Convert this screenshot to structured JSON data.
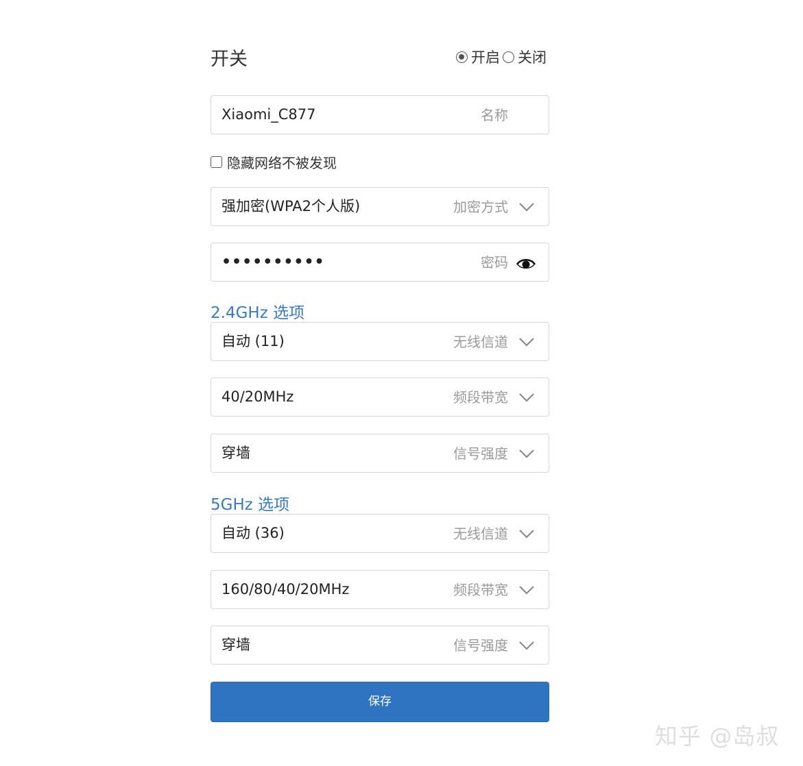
{
  "switch": {
    "title": "开关",
    "on_label": "开启",
    "off_label": "关闭",
    "selected": "on"
  },
  "name_field": {
    "value": "Xiaomi_C877",
    "hint": "名称"
  },
  "hide_network": {
    "label": "隐藏网络不被发现",
    "checked": false
  },
  "encryption": {
    "value": "强加密(WPA2个人版)",
    "hint": "加密方式"
  },
  "password": {
    "value": "••••••••••",
    "hint": "密码"
  },
  "band_24": {
    "title": "2.4GHz 选项",
    "channel": {
      "value": "自动 (11)",
      "hint": "无线信道"
    },
    "bandwidth": {
      "value": "40/20MHz",
      "hint": "频段带宽"
    },
    "signal": {
      "value": "穿墙",
      "hint": "信号强度"
    }
  },
  "band_5": {
    "title": "5GHz 选项",
    "channel": {
      "value": "自动 (36)",
      "hint": "无线信道"
    },
    "bandwidth": {
      "value": "160/80/40/20MHz",
      "hint": "频段带宽"
    },
    "signal": {
      "value": "穿墙",
      "hint": "信号强度"
    }
  },
  "save_label": "保存",
  "watermark": "知乎 @岛叔",
  "colors": {
    "accent": "#2f74c0",
    "section_title": "#3a7abf",
    "hint": "#9a9a9a",
    "border": "#d6d6d6"
  },
  "icons": {
    "dropdown": "chevron-down-icon",
    "show_password": "eye-icon"
  }
}
